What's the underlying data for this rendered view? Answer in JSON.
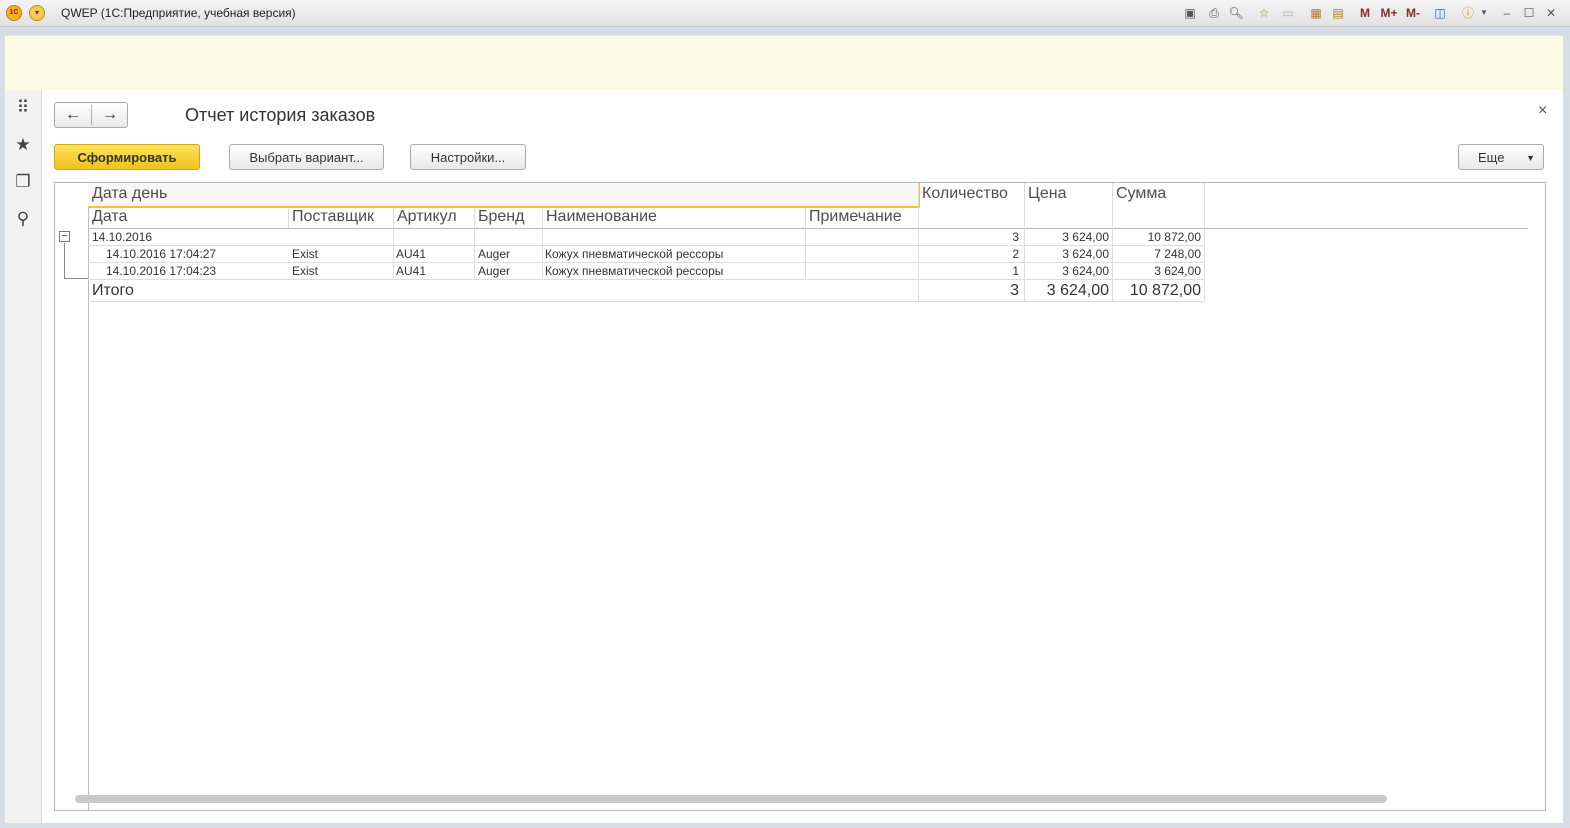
{
  "window": {
    "title": "QWEP  (1С:Предприятие, учебная версия)",
    "toolbar_m_labels": [
      "M",
      "M+",
      "M-"
    ]
  },
  "nav": {
    "back_icon": "arrow-left-icon",
    "forward_icon": "arrow-right-icon"
  },
  "form": {
    "title": "Отчет история заказов",
    "close": "×"
  },
  "buttons": {
    "generate": "Сформировать",
    "choose_variant": "Выбрать вариант...",
    "settings": "Настройки...",
    "more": "Еще"
  },
  "report": {
    "group_header": "Дата день",
    "headers": {
      "date": "Дата",
      "supplier": "Поставщик",
      "article": "Артикул",
      "brand": "Бренд",
      "name": "Наименование",
      "note": "Примечание",
      "quantity": "Количество",
      "price": "Цена",
      "sum": "Сумма"
    },
    "group": {
      "date": "14.10.2016",
      "quantity": "3",
      "price": "3 624,00",
      "sum": "10 872,00"
    },
    "rows": [
      {
        "date": "14.10.2016 17:04:27",
        "supplier": "Exist",
        "article": "AU41",
        "brand": "Auger",
        "name": "Кожух пневматической рессоры",
        "note": "",
        "quantity": "2",
        "price": "3 624,00",
        "sum": "7 248,00"
      },
      {
        "date": "14.10.2016 17:04:23",
        "supplier": "Exist",
        "article": "AU41",
        "brand": "Auger",
        "name": "Кожух пневматической рессоры",
        "note": "",
        "quantity": "1",
        "price": "3 624,00",
        "sum": "3 624,00"
      }
    ],
    "total": {
      "label": "Итого",
      "quantity": "3",
      "price": "3 624,00",
      "sum": "10 872,00"
    }
  },
  "colors": {
    "primary_button": "#f5cf2f",
    "notice_bar": "#fbfbe3",
    "group_header_border": "#f0c23a"
  }
}
